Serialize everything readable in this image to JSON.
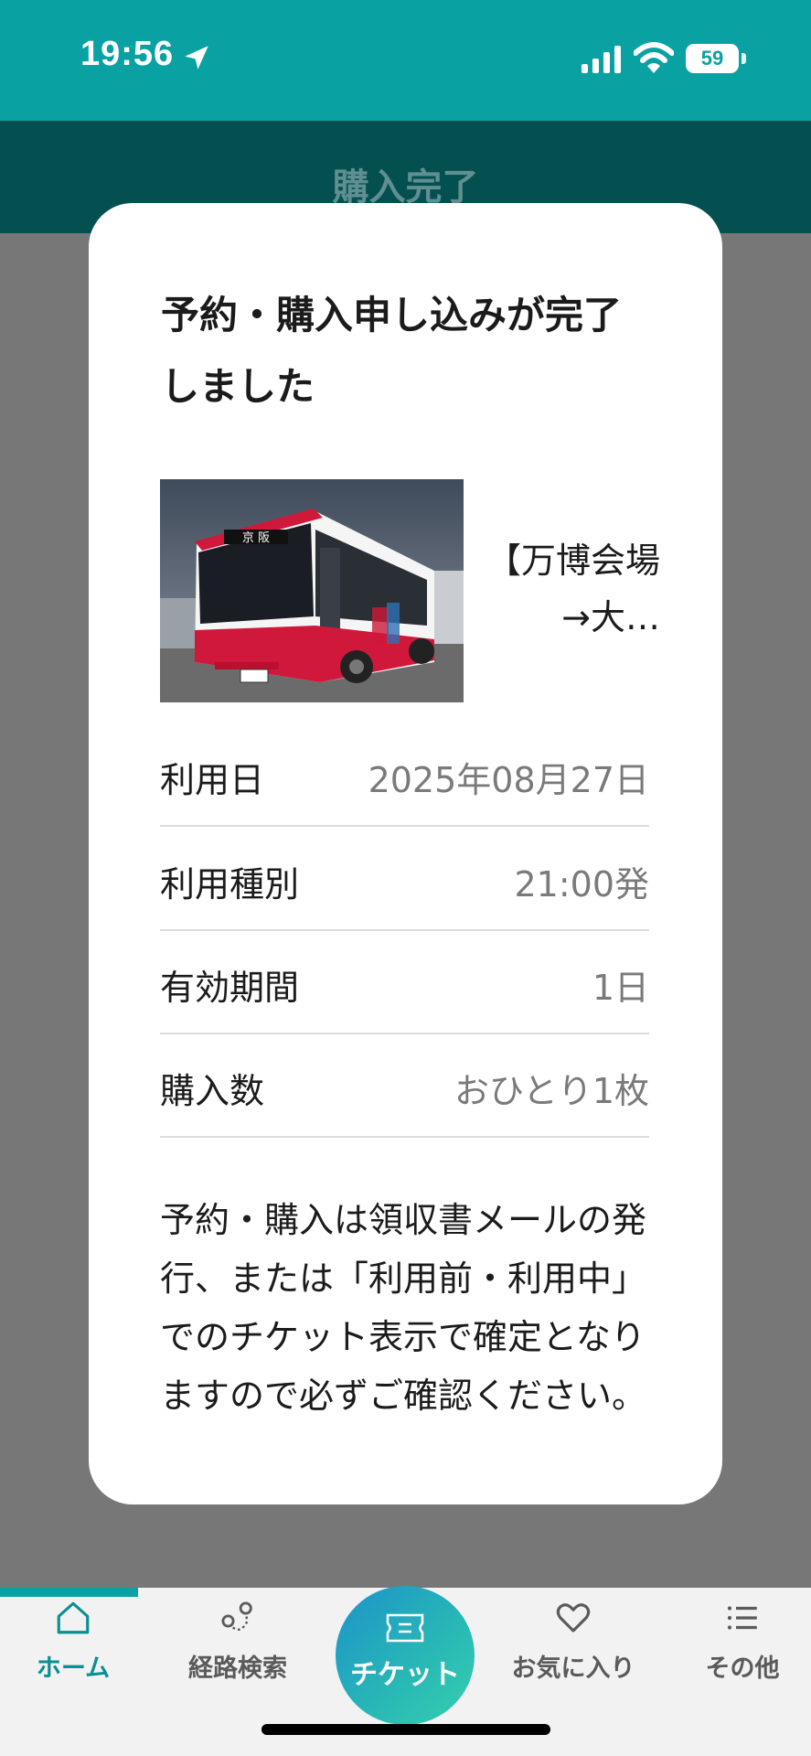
{
  "status_bar": {
    "time": "19:56",
    "battery": "59"
  },
  "header": {
    "title": "購入完了"
  },
  "modal": {
    "title": "予約・購入申し込みが完了しました",
    "product": {
      "image_icon": "bus-photo",
      "name": "【万博会場→大…"
    },
    "details": [
      {
        "label": "利用日",
        "value": "2025年08月27日"
      },
      {
        "label": "利用種別",
        "value": "21:00発"
      },
      {
        "label": "有効期間",
        "value": "1日"
      },
      {
        "label": "購入数",
        "value": "おひとり1枚"
      }
    ],
    "note": "予約・購入は領収書メールの発行、または「利用前・利用中」でのチケット表示で確定となりますので必ずご確認ください。"
  },
  "bus_photo": {
    "destination_sign": "京 阪"
  },
  "tab_bar": {
    "home": "ホーム",
    "route": "経路検索",
    "ticket": "チケット",
    "favorites": "お気に入り",
    "other": "その他"
  }
}
